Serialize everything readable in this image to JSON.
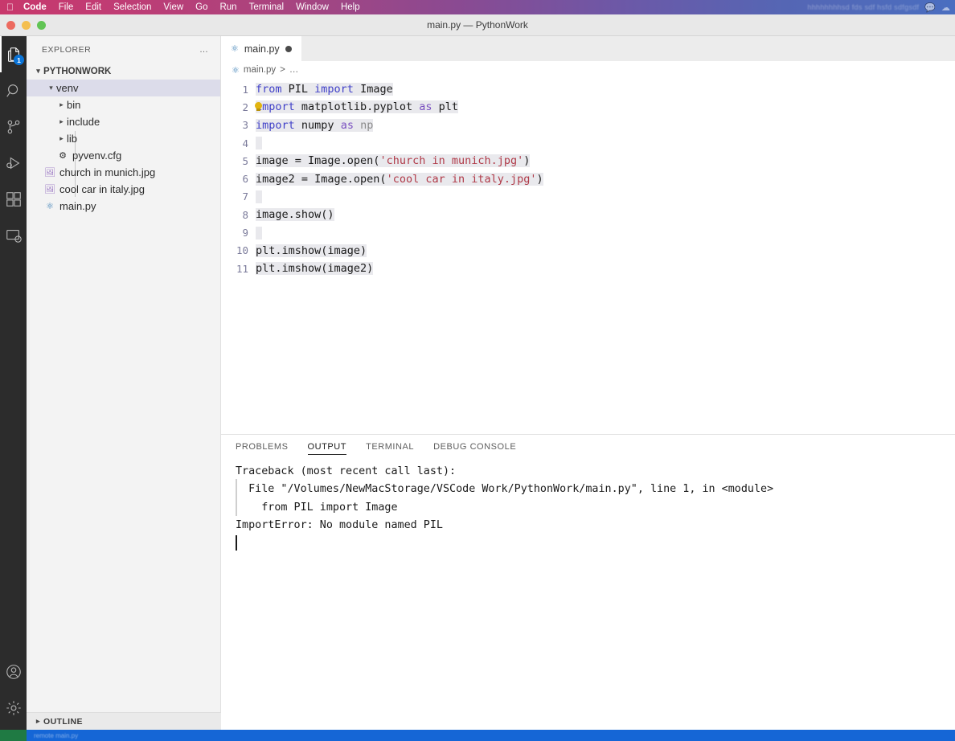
{
  "menubar": {
    "apple_glyph": "&#63743;",
    "items": [
      "Code",
      "File",
      "Edit",
      "Selection",
      "View",
      "Go",
      "Run",
      "Terminal",
      "Window",
      "Help"
    ],
    "right_blur_text": "hhhhhhhhsd fds sdf hsfd sdfgsdf",
    "right_icons": [
      "chat-icon",
      "cloud-icon"
    ]
  },
  "titlebar": {
    "title": "main.py — PythonWork",
    "traffic_lights": [
      "close",
      "minimize",
      "zoom"
    ],
    "colors": {
      "close": "#ec6a5f",
      "minimize": "#f4bf50",
      "zoom": "#61c454"
    }
  },
  "activitybar": {
    "items": [
      {
        "name": "explorer",
        "icon": "files-icon",
        "badge": "1",
        "active": true
      },
      {
        "name": "search",
        "icon": "search-icon",
        "badge": "",
        "active": false
      },
      {
        "name": "source-control",
        "icon": "source-control-icon",
        "badge": "",
        "active": false
      },
      {
        "name": "run-and-debug",
        "icon": "run-debug-icon",
        "badge": "",
        "active": false
      },
      {
        "name": "extensions",
        "icon": "extensions-icon",
        "badge": "",
        "active": false
      },
      {
        "name": "remote-explorer",
        "icon": "remote-explorer-icon",
        "badge": "",
        "active": false
      }
    ],
    "bottom_items": [
      {
        "name": "accounts",
        "icon": "account-icon"
      },
      {
        "name": "manage-settings",
        "icon": "gear-icon"
      }
    ]
  },
  "sidebar": {
    "header": "EXPLORER",
    "more_actions": "…",
    "root": {
      "label": "PYTHONWORK",
      "expanded": true
    },
    "tree": [
      {
        "label": "venv",
        "icon": "folder-icon",
        "indent": 0,
        "arrow": "v",
        "selected": true
      },
      {
        "label": "bin",
        "icon": "folder-icon",
        "indent": 1,
        "arrow": ">",
        "selected": false
      },
      {
        "label": "include",
        "icon": "folder-icon",
        "indent": 1,
        "arrow": ">",
        "selected": false
      },
      {
        "label": "lib",
        "icon": "folder-icon",
        "indent": 1,
        "arrow": ">",
        "selected": false
      },
      {
        "label": "pyvenv.cfg",
        "icon": "gear-file-icon",
        "indent": 1,
        "arrow": "",
        "selected": false
      },
      {
        "label": "church in munich.jpg",
        "icon": "image-file-icon",
        "indent": 0,
        "arrow": "",
        "selected": false
      },
      {
        "label": "cool car in italy.jpg",
        "icon": "image-file-icon",
        "indent": 0,
        "arrow": "",
        "selected": false
      },
      {
        "label": "main.py",
        "icon": "python-file-icon",
        "indent": 0,
        "arrow": "",
        "selected": false
      }
    ],
    "outline": {
      "label": "OUTLINE",
      "arrow": ">"
    }
  },
  "editor": {
    "tab": {
      "label": "main.py",
      "icon": "python-file-icon",
      "modified": true
    },
    "breadcrumb": {
      "icon": "python-file-icon",
      "file": "main.py",
      "separator": ">",
      "ellipsis": "…"
    },
    "lightbulb_line": 2,
    "lines": [
      {
        "n": "1",
        "text": "from PIL import Image"
      },
      {
        "n": "2",
        "text": "import matplotlib.pyplot as plt"
      },
      {
        "n": "3",
        "text": "import numpy as np"
      },
      {
        "n": "4",
        "text": ""
      },
      {
        "n": "5",
        "text": "image = Image.open('church in munich.jpg')"
      },
      {
        "n": "6",
        "text": "image2 = Image.open('cool car in italy.jpg')"
      },
      {
        "n": "7",
        "text": ""
      },
      {
        "n": "8",
        "text": "image.show()"
      },
      {
        "n": "9",
        "text": ""
      },
      {
        "n": "10",
        "text": "plt.imshow(image)"
      },
      {
        "n": "11",
        "text": "plt.imshow(image2)"
      }
    ],
    "colors": {
      "keyword": "#4040c8",
      "keyword_alt": "#7a50c0",
      "string": "#b03a48",
      "plain": "#1a1a1a"
    }
  },
  "panel": {
    "tabs": [
      {
        "label": "PROBLEMS",
        "active": false
      },
      {
        "label": "OUTPUT",
        "active": true
      },
      {
        "label": "TERMINAL",
        "active": false
      },
      {
        "label": "DEBUG CONSOLE",
        "active": false
      }
    ],
    "output_lines": [
      "Traceback (most recent call last):",
      "  File \"/Volumes/NewMacStorage/VSCode Work/PythonWork/main.py\", line 1, in <module>",
      "    from PIL import Image",
      "ImportError: No module named PIL"
    ]
  },
  "statusbar": {
    "background": "#1566d6",
    "accent": "#1f7a43",
    "text": "remote  main.py"
  }
}
